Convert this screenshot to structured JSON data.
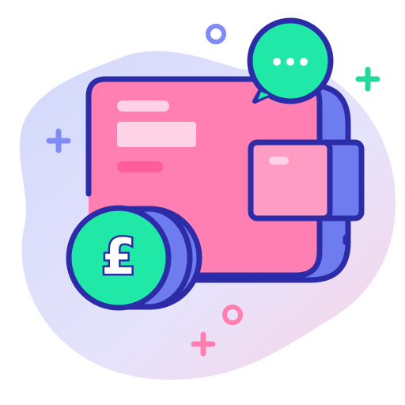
{
  "illustration": {
    "coin_symbol": "£",
    "speech_bubble_text": "•••",
    "icons": [
      "wallet-icon",
      "pound-coin-icon",
      "speech-bubble-icon",
      "plus-icon",
      "ring-icon"
    ],
    "colors": {
      "outline": "#2c2ca8",
      "wallet_pink": "#ff7fb2",
      "wallet_blue": "#6f7cf0",
      "coin_green": "#20e8a7",
      "blob_lavender": "#dbe0fb",
      "blob_pink": "#fbd6e8",
      "accent_blue": "#7f8cf6",
      "accent_green": "#23d89a",
      "accent_pink": "#ff7faf"
    }
  }
}
